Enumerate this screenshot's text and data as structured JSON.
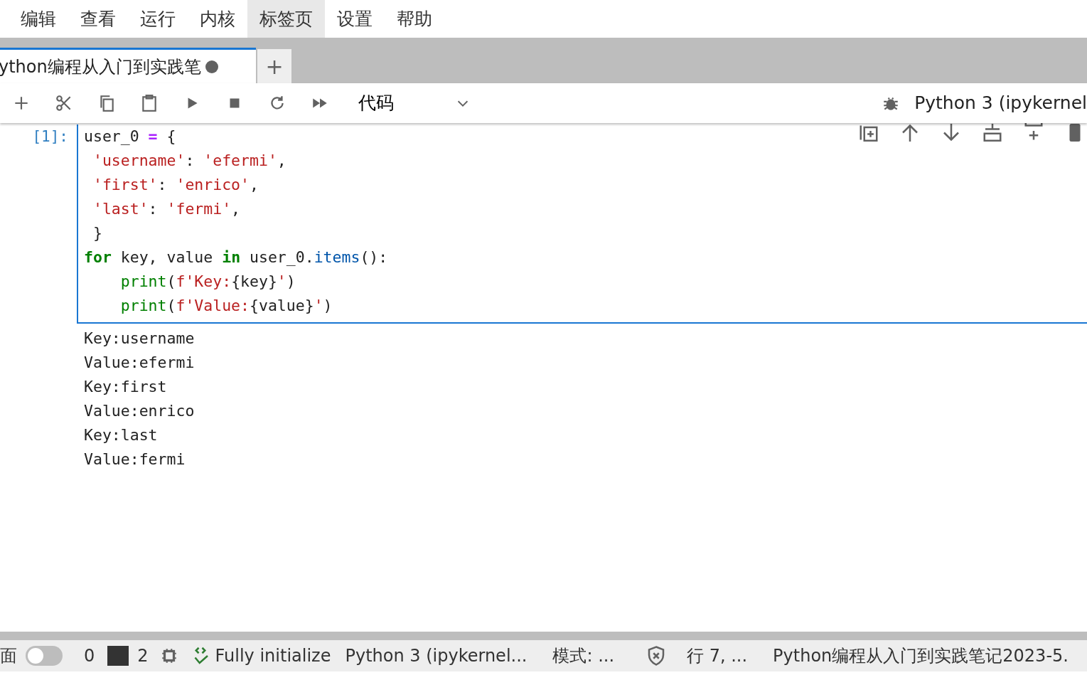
{
  "menu": [
    {
      "label": "编辑",
      "selected": false
    },
    {
      "label": "查看",
      "selected": false
    },
    {
      "label": "运行",
      "selected": false
    },
    {
      "label": "内核",
      "selected": false
    },
    {
      "label": "标签页",
      "selected": true
    },
    {
      "label": "设置",
      "selected": false
    },
    {
      "label": "帮助",
      "selected": false
    }
  ],
  "tabs": [
    {
      "label": "ython编程从入门到实践笔",
      "selected": true,
      "modified": true
    }
  ],
  "new_tab": "+",
  "toolbar": {
    "cell_type": "代码",
    "kernel": "Python 3 (ipykernel"
  },
  "cell": {
    "prompt": "[1]:",
    "lines": [
      [
        {
          "kind": "plain",
          "text": "user_0 "
        },
        {
          "kind": "op",
          "text": "="
        },
        {
          "kind": "plain",
          "text": " {"
        }
      ],
      [
        {
          "kind": "str",
          "text": " 'username'"
        },
        {
          "kind": "plain",
          "text": ": "
        },
        {
          "kind": "str",
          "text": "'efermi'"
        },
        {
          "kind": "plain",
          "text": ","
        }
      ],
      [
        {
          "kind": "str",
          "text": " 'first'"
        },
        {
          "kind": "plain",
          "text": ": "
        },
        {
          "kind": "str",
          "text": "'enrico'"
        },
        {
          "kind": "plain",
          "text": ","
        }
      ],
      [
        {
          "kind": "str",
          "text": " 'last'"
        },
        {
          "kind": "plain",
          "text": ": "
        },
        {
          "kind": "str",
          "text": "'fermi'"
        },
        {
          "kind": "plain",
          "text": ","
        }
      ],
      [
        {
          "kind": "plain",
          "text": " }"
        }
      ],
      [
        {
          "kind": "kw",
          "text": "for"
        },
        {
          "kind": "plain",
          "text": " key, value "
        },
        {
          "kind": "kw",
          "text": "in"
        },
        {
          "kind": "plain",
          "text": " user_0."
        },
        {
          "kind": "attr",
          "text": "items"
        },
        {
          "kind": "plain",
          "text": "():"
        }
      ],
      [
        {
          "kind": "builtin",
          "text": "    print"
        },
        {
          "kind": "plain",
          "text": "("
        },
        {
          "kind": "str",
          "text": "f'Key:"
        },
        {
          "kind": "plain",
          "text": "{key}"
        },
        {
          "kind": "str",
          "text": "'"
        },
        {
          "kind": "plain",
          "text": ")"
        }
      ],
      [
        {
          "kind": "builtin",
          "text": "    print"
        },
        {
          "kind": "plain",
          "text": "("
        },
        {
          "kind": "str",
          "text": "f'Value:"
        },
        {
          "kind": "plain",
          "text": "{value}"
        },
        {
          "kind": "str",
          "text": "'"
        },
        {
          "kind": "plain",
          "text": ")"
        }
      ]
    ],
    "output": [
      "Key:username",
      "Value:efermi",
      "Key:first",
      "Value:enrico",
      "Key:last",
      "Value:fermi"
    ]
  },
  "status_bar": {
    "edge_text": "面",
    "simple_mode_on": false,
    "terminals": "0",
    "kernels": "2",
    "lsp": "Fully initialize",
    "kernel": "Python 3 (ipykernel...",
    "mode": "模式: ...",
    "position": "行 7, ...",
    "file": "Python编程从入门到实践笔记2023-5."
  }
}
